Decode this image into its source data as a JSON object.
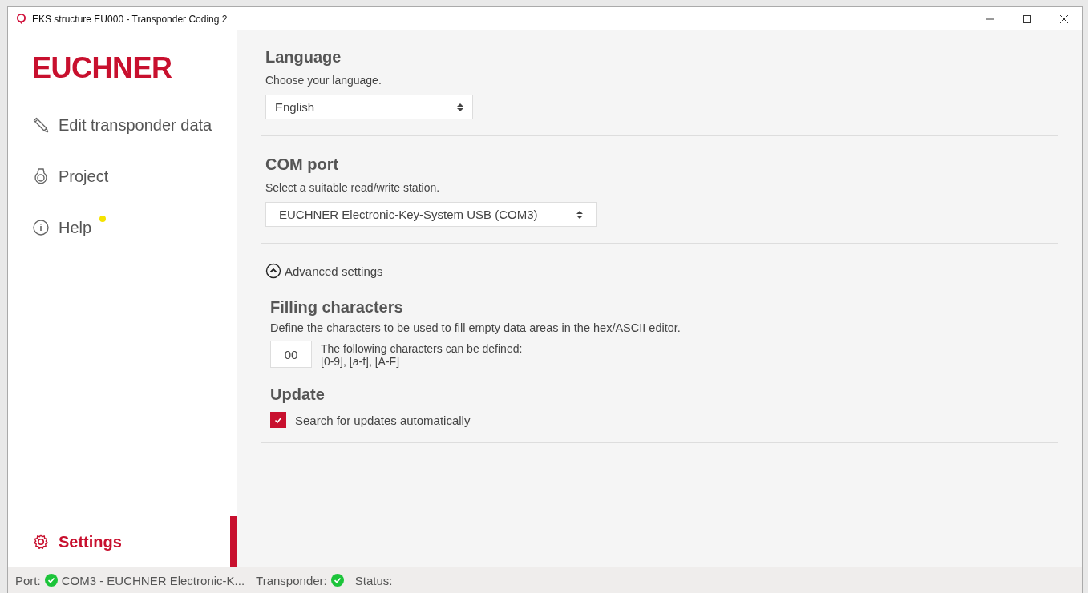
{
  "window": {
    "title": "EKS structure EU000 - Transponder Coding 2"
  },
  "sidebar": {
    "logo": "EUCHNER",
    "items": [
      {
        "label": "Edit transponder data",
        "selected": false,
        "notification": false
      },
      {
        "label": "Project",
        "selected": false,
        "notification": false
      },
      {
        "label": "Help",
        "selected": false,
        "notification": true
      }
    ],
    "footer_item": {
      "label": "Settings",
      "selected": true
    }
  },
  "language": {
    "title": "Language",
    "description": "Choose your language.",
    "value": "English"
  },
  "com_port": {
    "title": "COM port",
    "description": "Select a suitable read/write station.",
    "value": "EUCHNER Electronic-Key-System USB (COM3)"
  },
  "advanced": {
    "label": "Advanced settings",
    "expanded": true,
    "filling": {
      "title": "Filling characters",
      "description": "Define the characters to be used to fill empty data areas in the hex/ASCII editor.",
      "value": "00",
      "hint_lines": [
        "The following characters can be defined:",
        "[0-9], [a-f], [A-F]"
      ]
    },
    "update": {
      "title": "Update",
      "checkbox_label": "Search for updates automatically",
      "checked": true
    }
  },
  "status_bar": {
    "port_label": "Port:",
    "port_ok": true,
    "port_value": "COM3 - EUCHNER Electronic-K...",
    "transponder_label": "Transponder:",
    "transponder_ok": true,
    "status_label": "Status:"
  }
}
